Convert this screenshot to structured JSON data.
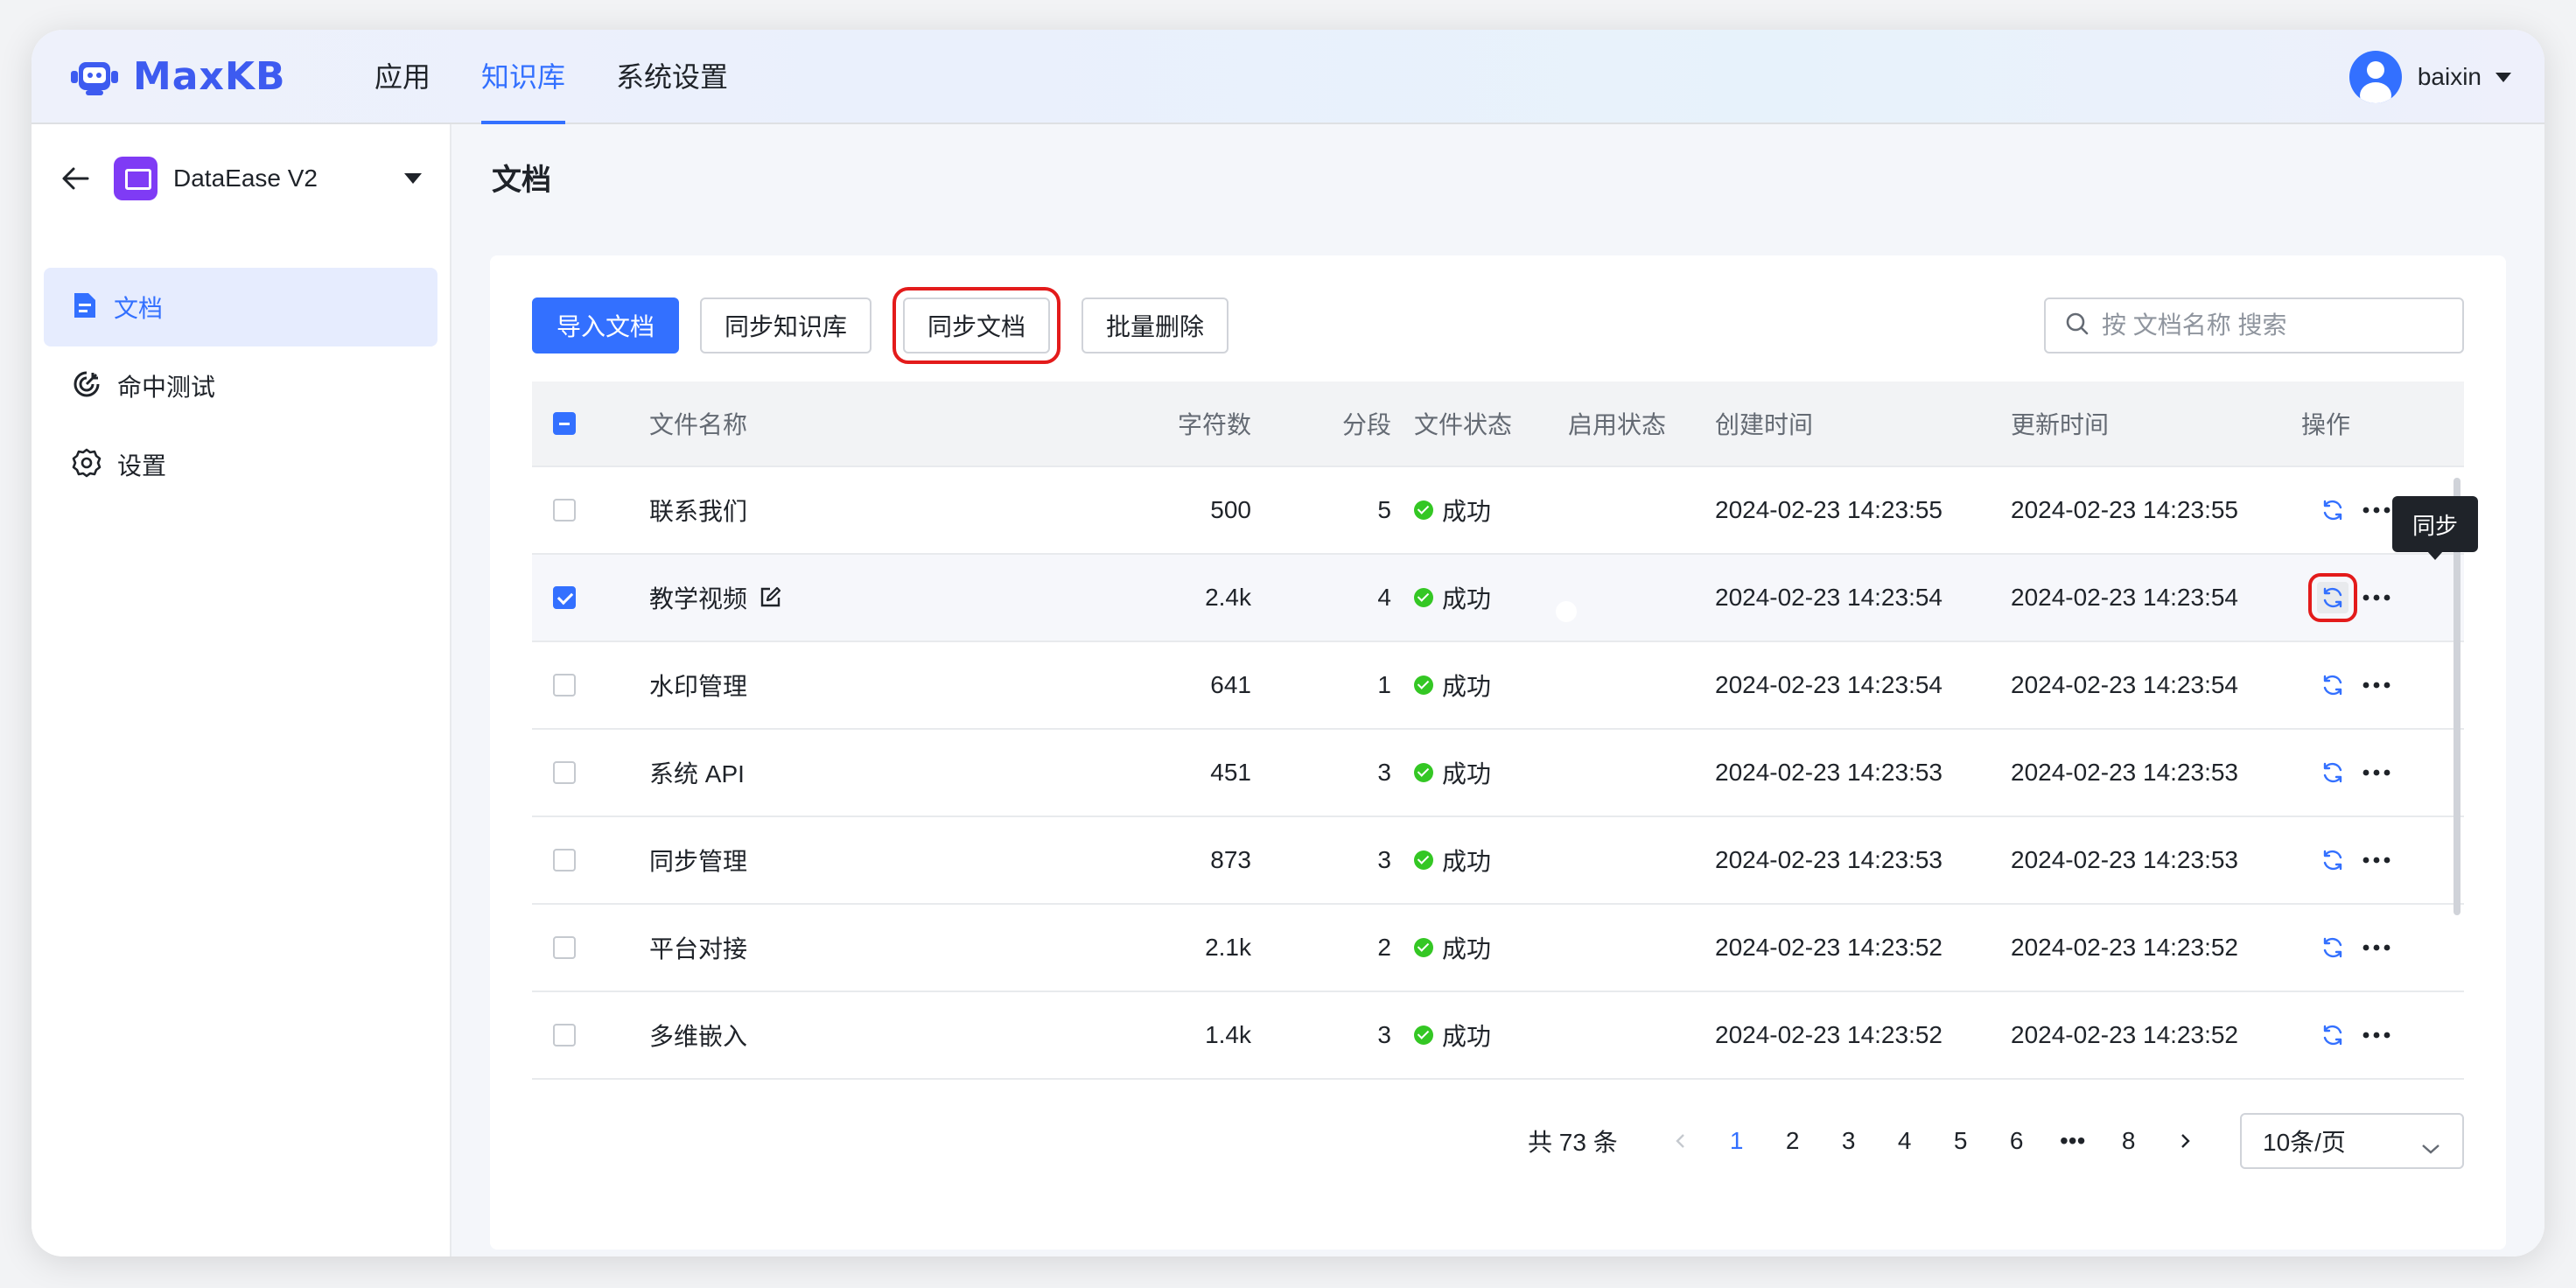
{
  "app": {
    "name": "MaxKB"
  },
  "nav": [
    {
      "label": "应用"
    },
    {
      "label": "知识库",
      "active": true
    },
    {
      "label": "系统设置"
    }
  ],
  "user": {
    "name": "baixin"
  },
  "sidebar": {
    "knowledge_base": "DataEase V2",
    "items": [
      {
        "label": "文档",
        "active": true
      },
      {
        "label": "命中测试"
      },
      {
        "label": "设置"
      }
    ]
  },
  "page": {
    "title": "文档"
  },
  "toolbar": {
    "import_label": "导入文档",
    "sync_kb_label": "同步知识库",
    "sync_doc_label": "同步文档",
    "batch_delete_label": "批量删除"
  },
  "search": {
    "placeholder": "按 文档名称 搜索",
    "value": ""
  },
  "table": {
    "headers": {
      "name": "文件名称",
      "chars": "字符数",
      "segments": "分段",
      "file_status": "文件状态",
      "enable_status": "启用状态",
      "created": "创建时间",
      "updated": "更新时间",
      "ops": "操作"
    },
    "rows": [
      {
        "name": "联系我们",
        "chars": "500",
        "segments": "5",
        "status": "成功",
        "enabled": true,
        "created": "2024-02-23 14:23:55",
        "updated": "2024-02-23 14:23:55",
        "checked": false
      },
      {
        "name": "教学视频",
        "chars": "2.4k",
        "segments": "4",
        "status": "成功",
        "enabled": true,
        "created": "2024-02-23 14:23:54",
        "updated": "2024-02-23 14:23:54",
        "checked": true
      },
      {
        "name": "水印管理",
        "chars": "641",
        "segments": "1",
        "status": "成功",
        "enabled": true,
        "created": "2024-02-23 14:23:54",
        "updated": "2024-02-23 14:23:54",
        "checked": false
      },
      {
        "name": "系统 API",
        "chars": "451",
        "segments": "3",
        "status": "成功",
        "enabled": true,
        "created": "2024-02-23 14:23:53",
        "updated": "2024-02-23 14:23:53",
        "checked": false
      },
      {
        "name": "同步管理",
        "chars": "873",
        "segments": "3",
        "status": "成功",
        "enabled": true,
        "created": "2024-02-23 14:23:53",
        "updated": "2024-02-23 14:23:53",
        "checked": false
      },
      {
        "name": "平台对接",
        "chars": "2.1k",
        "segments": "2",
        "status": "成功",
        "enabled": true,
        "created": "2024-02-23 14:23:52",
        "updated": "2024-02-23 14:23:52",
        "checked": false
      },
      {
        "name": "多维嵌入",
        "chars": "1.4k",
        "segments": "3",
        "status": "成功",
        "enabled": true,
        "created": "2024-02-23 14:23:52",
        "updated": "2024-02-23 14:23:52",
        "checked": false
      }
    ]
  },
  "tooltip": {
    "text": "同步"
  },
  "pagination": {
    "total": "共 73 条",
    "pages": [
      "1",
      "2",
      "3",
      "4",
      "5",
      "6",
      "•••",
      "8"
    ],
    "current": "1",
    "page_size": "10条/页"
  },
  "colors": {
    "accent": "#3370ff",
    "success": "#34c724",
    "highlight": "#e31b1b",
    "logo": "#3d5bf0"
  },
  "icons": [
    "robot-logo-icon",
    "back-arrow-icon",
    "document-icon",
    "target-icon",
    "gear-icon",
    "search-icon",
    "edit-icon",
    "sync-icon",
    "more-icon",
    "chevron-left-icon",
    "chevron-right-icon",
    "chevron-down-icon"
  ]
}
